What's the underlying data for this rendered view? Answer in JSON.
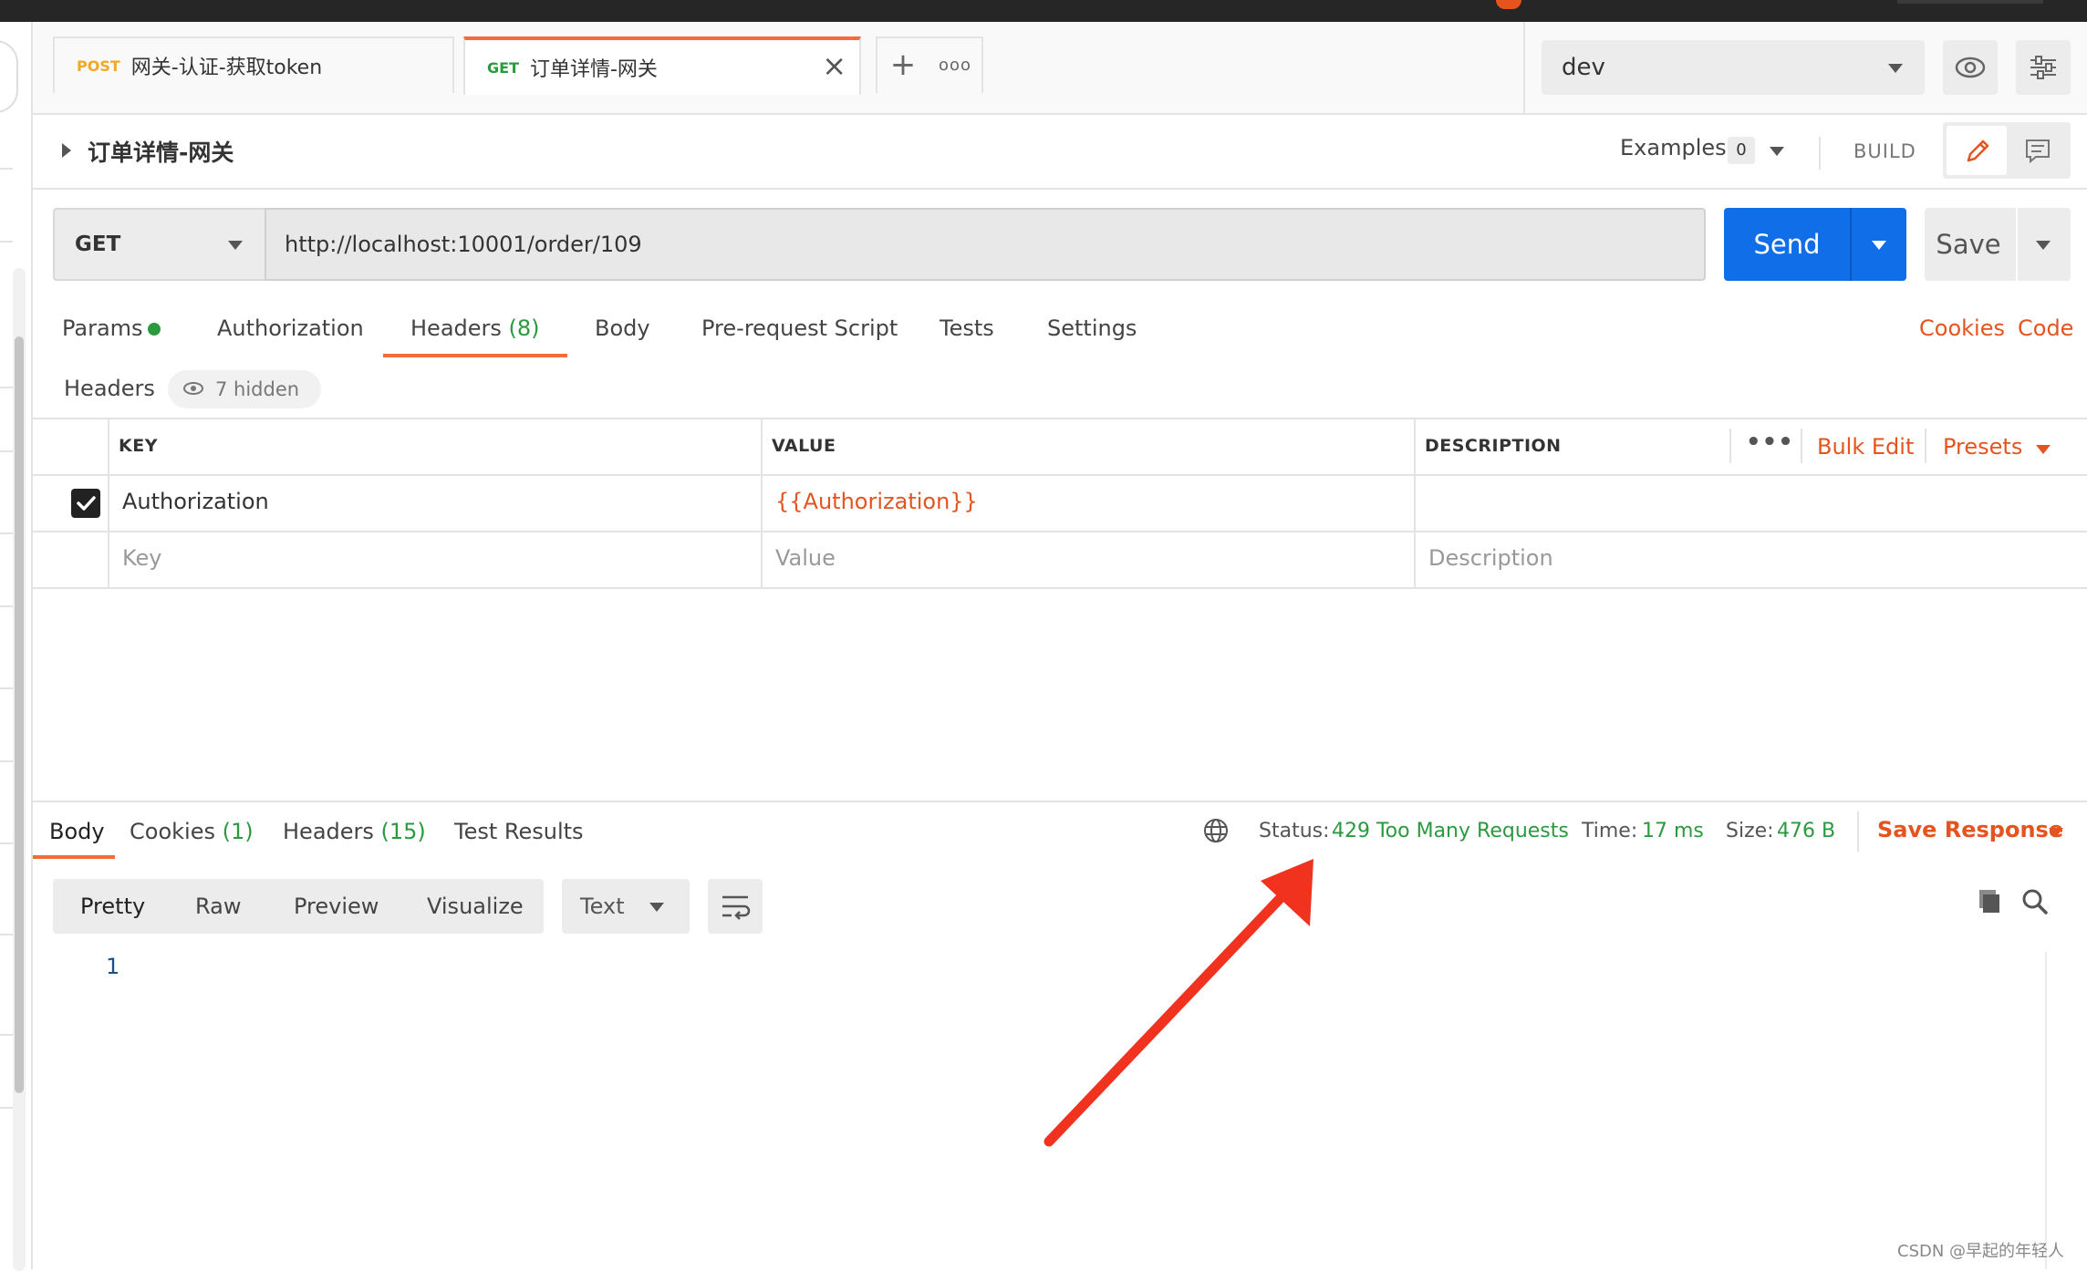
{
  "tabs": [
    {
      "method": "POST",
      "title": "网关-认证-获取token",
      "method_color": "#f5a623"
    },
    {
      "method": "GET",
      "title": "订单详情-网关",
      "method_color": "#2b9a3f"
    }
  ],
  "environment": {
    "selected": "dev"
  },
  "request": {
    "title": "订单详情-网关",
    "examples_label": "Examples",
    "examples_count": "0",
    "build_label": "BUILD",
    "method": "GET",
    "url": "http://localhost:10001/order/109",
    "send_label": "Send",
    "save_label": "Save"
  },
  "request_tabs": {
    "params": "Params",
    "authorization": "Authorization",
    "headers": "Headers",
    "headers_count": "(8)",
    "body": "Body",
    "pre_request": "Pre-request Script",
    "tests": "Tests",
    "settings": "Settings",
    "cookies": "Cookies",
    "code": "Code"
  },
  "headers_section": {
    "label": "Headers",
    "hidden": "7 hidden",
    "columns": {
      "key": "KEY",
      "value": "VALUE",
      "description": "DESCRIPTION"
    },
    "bulk_edit": "Bulk Edit",
    "presets": "Presets",
    "rows": [
      {
        "checked": true,
        "key": "Authorization",
        "value": "{{Authorization}}",
        "description": ""
      }
    ],
    "placeholders": {
      "key": "Key",
      "value": "Value",
      "description": "Description"
    }
  },
  "response": {
    "tabs": {
      "body": "Body",
      "cookies": "Cookies",
      "cookies_count": "(1)",
      "headers": "Headers",
      "headers_count": "(15)",
      "test_results": "Test Results"
    },
    "status_label": "Status:",
    "status_value": "429 Too Many Requests",
    "time_label": "Time:",
    "time_value": "17 ms",
    "size_label": "Size:",
    "size_value": "476 B",
    "save_response": "Save Response",
    "formats": [
      "Pretty",
      "Raw",
      "Preview",
      "Visualize"
    ],
    "type_select": "Text",
    "line_number": "1"
  },
  "watermark": "CSDN @早起的年轻人",
  "colors": {
    "accent": "#f26b3a",
    "send": "#0f6ee8",
    "green": "#2b9a3f",
    "annotation_arrow": "#f0321e"
  }
}
